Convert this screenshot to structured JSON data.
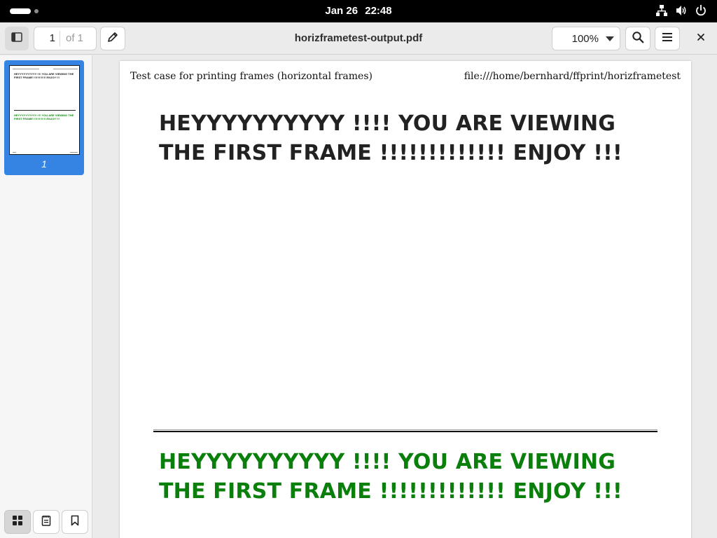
{
  "topbar": {
    "date": "Jan 26",
    "time": "22:48",
    "icons": [
      "activities-indicator",
      "network-icon",
      "volume-icon",
      "power-icon"
    ]
  },
  "headerbar": {
    "page_number": "1",
    "page_count": "of 1",
    "title": "horizframetest-output.pdf",
    "zoom": "100%",
    "icons": [
      "sidebar-toggle-icon",
      "pencil-icon",
      "chevron-down-icon",
      "search-icon",
      "hamburger-menu-icon",
      "close-icon"
    ]
  },
  "sidebar": {
    "thumbnails": [
      {
        "label": "1",
        "header_left": "Test case for printing frames (horizontal frames)",
        "header_right": "file:///home/bernhard/ffprint/horizframetest",
        "frame1": "HEYYYYYYYYYY !!!! YOU ARE VIEWING THE FIRST FRAME !!!!!!!!!!!!! ENJOY !!!",
        "frame2": "HEYYYYYYYYYY !!!! YOU ARE VIEWING THE FIRST FRAME !!!!!!!!!!!!! ENJOY !!!"
      }
    ],
    "tabs": [
      "thumbnails-grid-icon",
      "outline-document-icon",
      "bookmark-icon"
    ]
  },
  "document": {
    "header_left": "Test case for printing frames (horizontal frames)",
    "header_right": "file:///home/bernhard/ffprint/horizframetest",
    "frame1_text": "HEYYYYYYYYYY !!!! YOU ARE VIEWING THE FIRST FRAME !!!!!!!!!!!!! ENJOY !!!",
    "frame2_text": "HEYYYYYYYYYY !!!! YOU ARE VIEWING THE FIRST FRAME !!!!!!!!!!!!! ENJOY !!!",
    "frame1_color": "#222222",
    "frame2_color": "#0b7f0b"
  },
  "colors": {
    "accent": "#3584e4",
    "topbar": "#000000",
    "headerbar": "#ebebeb"
  }
}
